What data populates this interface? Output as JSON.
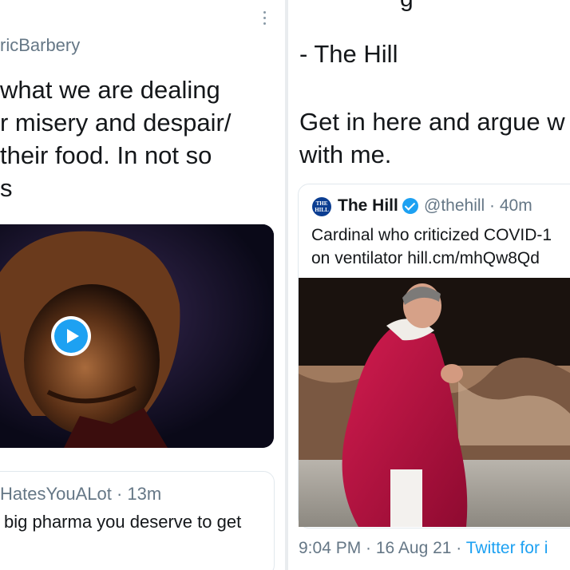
{
  "left_tweet": {
    "handle": "ricBarbery",
    "text_lines": [
      "what we are dealing",
      "r misery and despair/",
      "their food. In not so",
      "s"
    ]
  },
  "reply": {
    "header": "HatesYouALot · 13m",
    "text": "big pharma you deserve to get"
  },
  "right_tweet": {
    "top_peek": "g",
    "line1": "- The Hill",
    "line2": "Get in here and argue w",
    "line3": "with me."
  },
  "quote": {
    "logo_text": "THE HILL",
    "name": "The Hill",
    "handle_time": "@thehill · 40m",
    "text_line1": "Cardinal who criticized COVID-1",
    "text_line2": "on ventilator hill.cm/mhQw8Qd"
  },
  "footer": {
    "timestamp": "9:04 PM · 16 Aug 21 · ",
    "source": "Twitter for i"
  },
  "colors": {
    "accent": "#1da1f2",
    "muted": "#657786"
  }
}
